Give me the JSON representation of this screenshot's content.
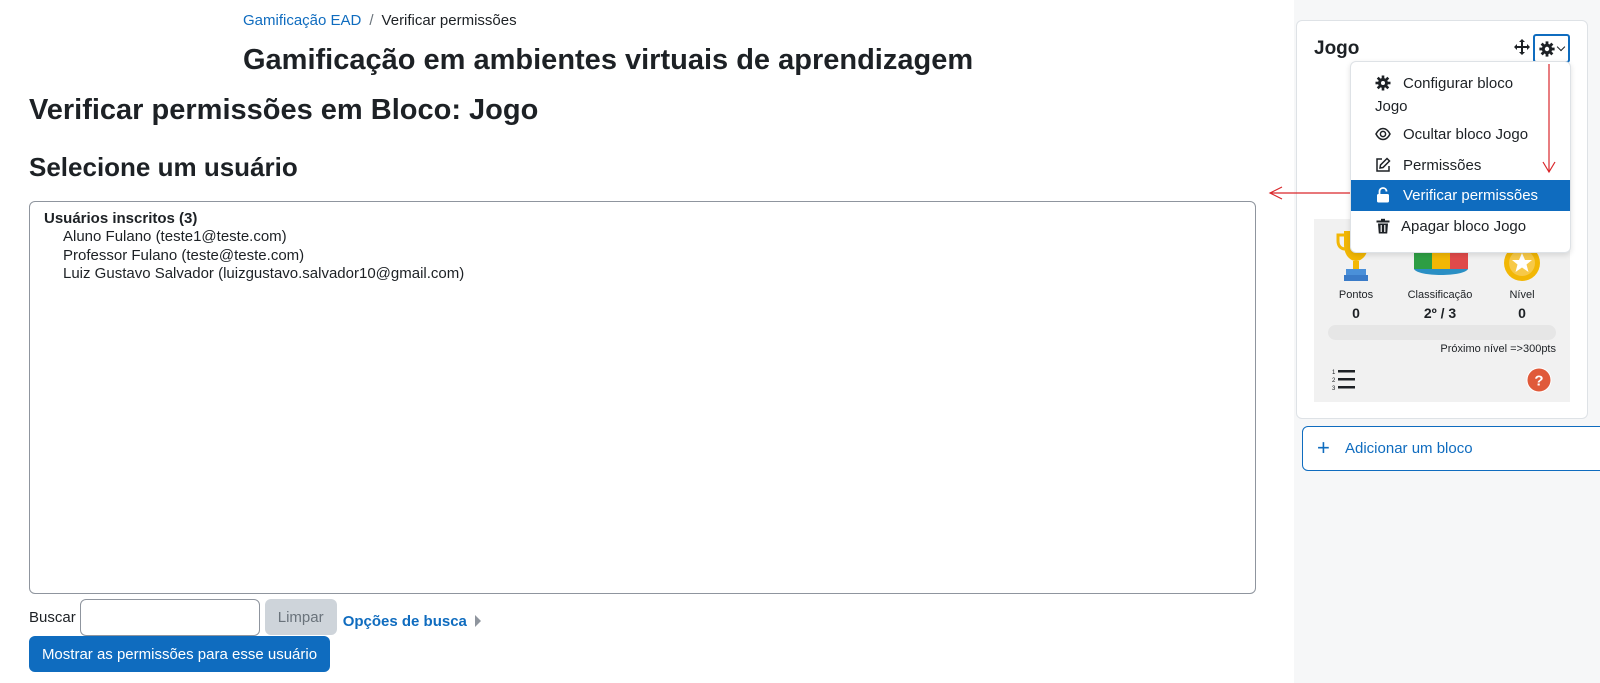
{
  "breadcrumb": {
    "course": "Gamificação EAD",
    "separator": "/",
    "current": "Verificar permissões"
  },
  "course_title": "Gamificação em ambientes virtuais de aprendizagem",
  "page_heading": "Verificar permissões em Bloco: Jogo",
  "section_heading": "Selecione um usuário",
  "users": {
    "group_label": "Usuários inscritos (3)",
    "options": [
      "Aluno Fulano (teste1@teste.com)",
      "Professor Fulano (teste@teste.com)",
      "Luiz Gustavo Salvador (luizgustavo.salvador10@gmail.com)"
    ]
  },
  "search": {
    "label": "Buscar",
    "value": "",
    "clear_label": "Limpar",
    "options_label": "Opções de busca"
  },
  "show_button": "Mostrar as permissões para esse usuário",
  "block": {
    "title": "Jogo",
    "menu": [
      {
        "label_line1": "Configurar bloco",
        "label_line2": "Jogo",
        "icon": "gear-icon"
      },
      {
        "label": "Ocultar bloco Jogo",
        "icon": "eye-icon"
      },
      {
        "label": "Permissões",
        "icon": "edit-icon"
      },
      {
        "label": "Verificar permissões",
        "icon": "unlock-icon",
        "active": true
      },
      {
        "label": "Apagar bloco Jogo",
        "icon": "trash-icon"
      }
    ],
    "stats": {
      "points_label": "Pontos",
      "points_value": "0",
      "rank_label": "Classificação",
      "rank_value": "2º / 3",
      "level_label": "Nível",
      "level_value": "0",
      "progress_fraction": 0,
      "next_level": "Próximo nível =>300pts"
    }
  },
  "add_block": {
    "label": "Adicionar um bloco",
    "icon": "plus-icon"
  },
  "colors": {
    "primary": "#0f6cbf",
    "annotation": "#d9262a",
    "drawer_bg": "#f6f7f8"
  }
}
